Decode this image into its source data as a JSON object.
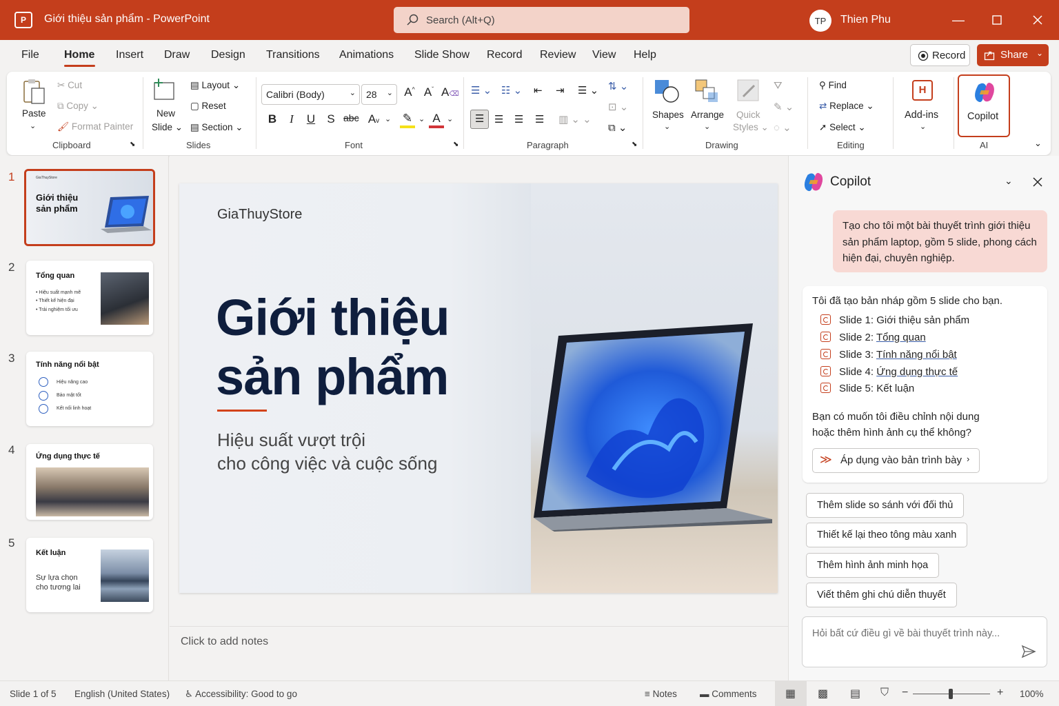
{
  "app": {
    "title": "Giới thiệu sản phẩm - PowerPoint",
    "logo": "P"
  },
  "search": {
    "placeholder": "Search (Alt+Q)"
  },
  "user": {
    "initials": "TP",
    "name": "Thien Phu"
  },
  "tabs": [
    "File",
    "Home",
    "Insert",
    "Draw",
    "Design",
    "Transitions",
    "Animations",
    "Slide Show",
    "Record",
    "Review",
    "View",
    "Help"
  ],
  "active_tab": "Home",
  "actions": {
    "record": "Record",
    "share": "Share"
  },
  "ribbon": {
    "clipboard": {
      "paste": "Paste",
      "cut": "Cut",
      "copy": "Copy",
      "format_painter": "Format Painter",
      "label": "Clipboard"
    },
    "slides": {
      "new_slide_1": "New",
      "new_slide_2": "Slide",
      "layout": "Layout",
      "reset": "Reset",
      "section": "Section",
      "label": "Slides"
    },
    "font": {
      "name": "Calibri (Body)",
      "size": "28",
      "label": "Font"
    },
    "paragraph": {
      "label": "Paragraph"
    },
    "drawing": {
      "shapes": "Shapes",
      "arrange": "Arrange",
      "quick_1": "Quick",
      "quick_2": "Styles",
      "label": "Drawing"
    },
    "editing": {
      "find": "Find",
      "replace": "Replace",
      "select": "Select",
      "label": "Editing"
    },
    "addins": {
      "label": "Add-ins"
    },
    "ai": {
      "copilot": "Copilot",
      "label": "AI"
    }
  },
  "thumbnails": [
    {
      "num": "1",
      "brand": "GiaThuyStore",
      "title_1": "Giới thiệu",
      "title_2": "sản phẩm"
    },
    {
      "num": "2",
      "title": "Tổng quan",
      "bullets": [
        "• Hiệu suất mạnh mẽ",
        "• Thiết kế hiện đại",
        "• Trải nghiệm tối ưu"
      ]
    },
    {
      "num": "3",
      "title": "Tính năng nổi bật",
      "items": [
        "Hiệu năng cao",
        "Bảo mật tốt",
        "Kết nối linh hoạt"
      ]
    },
    {
      "num": "4",
      "title": "Ứng dụng thực tế"
    },
    {
      "num": "5",
      "title": "Kết luận",
      "sub_1": "Sự lựa chọn",
      "sub_2": "cho tương lai"
    }
  ],
  "slide": {
    "brand": "GiaThuyStore",
    "title_1": "Giới thiệu",
    "title_2": "sản phẩm",
    "subtitle_1": "Hiệu suất vượt trội",
    "subtitle_2": "cho công việc và cuộc sống",
    "accent": "#d3431a"
  },
  "notes": {
    "placeholder": "Click to add notes"
  },
  "copilot": {
    "title": "Copilot",
    "user_message": "Tạo cho tôi một bài thuyết trình giới thiệu sản phẩm laptop, gồm 5 slide, phong cách hiện đại, chuyên nghiệp.",
    "reply_intro": "Tôi đã tạo bản nháp gồm 5 slide cho bạn.",
    "slide_refs": [
      {
        "prefix": "Slide 1:",
        "name": "Giới thiệu sản phẩm"
      },
      {
        "prefix": "Slide 2:",
        "name": "Tổng quan"
      },
      {
        "prefix": "Slide 3:",
        "name": "Tính năng nổi bật"
      },
      {
        "prefix": "Slide 4:",
        "name": "Ứng dụng thực tế"
      },
      {
        "prefix": "Slide 5:",
        "name": "Kết luận"
      }
    ],
    "followup_1": "Bạn có muốn tôi điều chỉnh nội dung",
    "followup_2": "hoặc thêm hình ảnh cụ thể không?",
    "apply_button": "Áp dụng vào bản trình bày",
    "suggestions": [
      "Thêm slide so sánh với đối thủ",
      "Thiết kế lại theo tông màu xanh",
      "Thêm hình ảnh minh họa",
      "Viết thêm ghi chú diễn thuyết"
    ],
    "input_placeholder": "Hỏi bất cứ điều gì về bài thuyết trình này..."
  },
  "status": {
    "slide_of": "Slide 1 of 5",
    "language": "English (United States)",
    "accessibility": "Accessibility: Good to go",
    "notes": "Notes",
    "comments": "Comments",
    "zoom": "100%",
    "zoom_level": 1.0
  },
  "colors": {
    "brand": "#c43e1c",
    "copilot_user_bubble": "#f8d9d4",
    "slide_title": "#0f1e3d"
  }
}
